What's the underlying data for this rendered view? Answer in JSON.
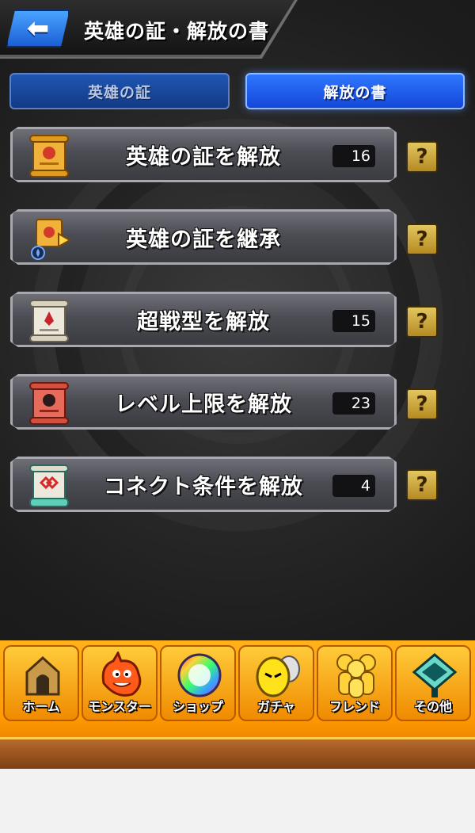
{
  "header": {
    "title": "英雄の証・解放の書",
    "back_icon": "back-arrow-icon"
  },
  "tabs": [
    {
      "label": "英雄の証",
      "active": false
    },
    {
      "label": "解放の書",
      "active": true
    }
  ],
  "menu": [
    {
      "label": "英雄の証を解放",
      "count": "16",
      "icon": "scroll-icon-gold",
      "color": "#f0b23a"
    },
    {
      "label": "英雄の証を継承",
      "count": null,
      "icon": "scroll-transfer-icon",
      "color": "#f0b23a"
    },
    {
      "label": "超戦型を解放",
      "count": "15",
      "icon": "scroll-icon-white",
      "color": "#e8e4d8"
    },
    {
      "label": "レベル上限を解放",
      "count": "23",
      "icon": "scroll-icon-red",
      "color": "#e86a5a"
    },
    {
      "label": "コネクト条件を解放",
      "count": "4",
      "icon": "scroll-icon-teal",
      "color": "#5fd0b8"
    }
  ],
  "help_label": "?",
  "nav": [
    {
      "label": "ホーム",
      "icon": "home-icon"
    },
    {
      "label": "モンスター",
      "icon": "monster-icon"
    },
    {
      "label": "ショップ",
      "icon": "shop-orb-icon"
    },
    {
      "label": "ガチャ",
      "icon": "gacha-egg-icon"
    },
    {
      "label": "フレンド",
      "icon": "friends-icon"
    },
    {
      "label": "その他",
      "icon": "other-icon"
    }
  ]
}
